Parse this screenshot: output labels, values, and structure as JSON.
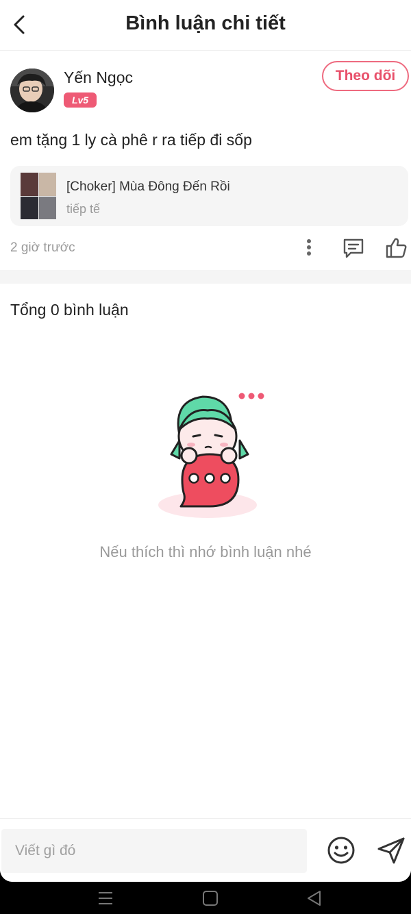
{
  "header": {
    "title": "Bình luận chi tiết"
  },
  "author": {
    "name": "Yến Ngọc",
    "level": "Lv5",
    "follow_label": "Theo dõi"
  },
  "post": {
    "text": "em tặng 1 ly cà phê r ra tiếp đi sốp",
    "linked_card": {
      "title": "[Choker] Mùa Đông Đến Rồi",
      "subtitle": "tiếp tế"
    },
    "time": "2 giờ trước"
  },
  "comments": {
    "count_label": "Tổng 0 bình luận",
    "empty_message": "Nếu thích thì nhớ bình luận nhé"
  },
  "input": {
    "placeholder": "Viết gì đó"
  },
  "colors": {
    "accent": "#ee5a75",
    "mascot_hair": "#5fd9a8",
    "bubble": "#ee4d5f"
  }
}
